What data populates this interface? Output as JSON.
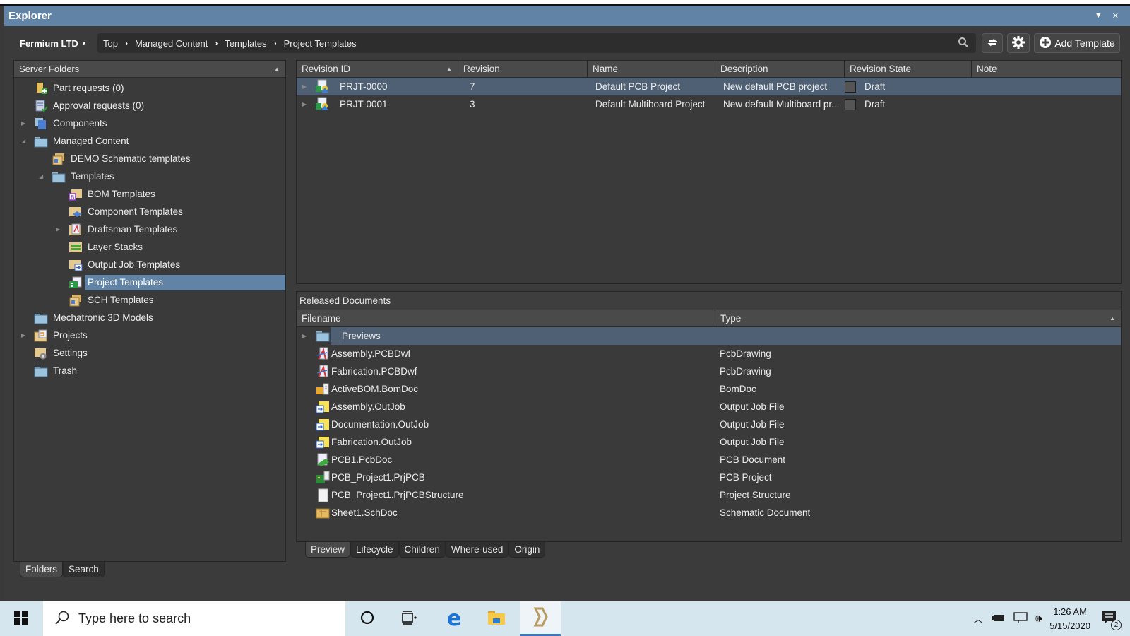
{
  "window": {
    "title": "Explorer"
  },
  "toolbar": {
    "org": "Fermium LTD",
    "breadcrumb": [
      "Top",
      "Managed Content",
      "Templates",
      "Project Templates"
    ],
    "add_label": "Add Template"
  },
  "server_folders": {
    "header": "Server Folders",
    "items": [
      {
        "label": "Part requests (0)",
        "level": 0,
        "expander": "none",
        "icon": "part-request-icon"
      },
      {
        "label": "Approval requests (0)",
        "level": 0,
        "expander": "none",
        "icon": "approval-request-icon"
      },
      {
        "label": "Components",
        "level": 0,
        "expander": "collapsed",
        "icon": "components-icon"
      },
      {
        "label": "Managed Content",
        "level": 0,
        "expander": "expanded",
        "icon": "folder-icon"
      },
      {
        "label": "DEMO Schematic templates",
        "level": 1,
        "expander": "none",
        "icon": "sch-templates-icon"
      },
      {
        "label": "Templates",
        "level": 1,
        "expander": "expanded",
        "icon": "folder-icon"
      },
      {
        "label": "BOM Templates",
        "level": 2,
        "expander": "none",
        "icon": "bom-templates-icon"
      },
      {
        "label": "Component Templates",
        "level": 2,
        "expander": "none",
        "icon": "component-templates-icon"
      },
      {
        "label": "Draftsman Templates",
        "level": 2,
        "expander": "collapsed",
        "icon": "draftsman-templates-icon"
      },
      {
        "label": "Layer Stacks",
        "level": 2,
        "expander": "none",
        "icon": "layer-stacks-icon"
      },
      {
        "label": "Output Job Templates",
        "level": 2,
        "expander": "none",
        "icon": "outjob-templates-icon"
      },
      {
        "label": "Project Templates",
        "level": 2,
        "expander": "none",
        "icon": "project-templates-icon",
        "selected": true
      },
      {
        "label": "SCH Templates",
        "level": 2,
        "expander": "none",
        "icon": "sch-templates-icon"
      },
      {
        "label": "Mechatronic 3D Models",
        "level": 0,
        "expander": "none",
        "icon": "folder-icon"
      },
      {
        "label": "Projects",
        "level": 0,
        "expander": "collapsed",
        "icon": "projects-icon"
      },
      {
        "label": "Settings",
        "level": 0,
        "expander": "none",
        "icon": "settings-folder-icon"
      },
      {
        "label": "Trash",
        "level": 0,
        "expander": "none",
        "icon": "folder-icon"
      }
    ],
    "tabs": [
      "Folders",
      "Search"
    ],
    "active_tab": "Folders"
  },
  "revisions": {
    "columns": [
      "Revision ID",
      "Revision",
      "Name",
      "Description",
      "Revision State",
      "Note"
    ],
    "sort_column": "Revision ID",
    "rows": [
      {
        "id": "PRJT-0000",
        "revision": "7",
        "name": "Default PCB Project",
        "description": "New default PCB project",
        "state": "Draft",
        "note": "",
        "selected": true
      },
      {
        "id": "PRJT-0001",
        "revision": "3",
        "name": "Default Multiboard Project",
        "description": "New default Multiboard pr...",
        "state": "Draft",
        "note": ""
      }
    ]
  },
  "released_documents": {
    "title": "Released Documents",
    "columns": [
      "Filename",
      "Type"
    ],
    "rows": [
      {
        "filename": "__Previews",
        "type": "",
        "icon": "folder-icon",
        "expander": true,
        "selected": true
      },
      {
        "filename": "Assembly.PCBDwf",
        "type": "PcbDrawing",
        "icon": "pcbdwf-icon"
      },
      {
        "filename": "Fabrication.PCBDwf",
        "type": "PcbDrawing",
        "icon": "pcbdwf-icon"
      },
      {
        "filename": "ActiveBOM.BomDoc",
        "type": "BomDoc",
        "icon": "bomdoc-icon"
      },
      {
        "filename": "Assembly.OutJob",
        "type": "Output Job File",
        "icon": "outjob-icon"
      },
      {
        "filename": "Documentation.OutJob",
        "type": "Output Job File",
        "icon": "outjob-icon"
      },
      {
        "filename": "Fabrication.OutJob",
        "type": "Output Job File",
        "icon": "outjob-icon"
      },
      {
        "filename": "PCB1.PcbDoc",
        "type": "PCB Document",
        "icon": "pcbdoc-icon"
      },
      {
        "filename": "PCB_Project1.PrjPCB",
        "type": "PCB Project",
        "icon": "prjpcb-icon"
      },
      {
        "filename": "PCB_Project1.PrjPCBStructure",
        "type": "Project Structure",
        "icon": "blank-document-icon"
      },
      {
        "filename": "Sheet1.SchDoc",
        "type": "Schematic Document",
        "icon": "schdoc-icon"
      }
    ],
    "tabs": [
      "Preview",
      "Lifecycle",
      "Children",
      "Where-used",
      "Origin"
    ],
    "active_tab": "Preview"
  },
  "taskbar": {
    "search_placeholder": "Type here to search",
    "time": "1:26 AM",
    "date": "5/15/2020",
    "notifications": "2"
  }
}
